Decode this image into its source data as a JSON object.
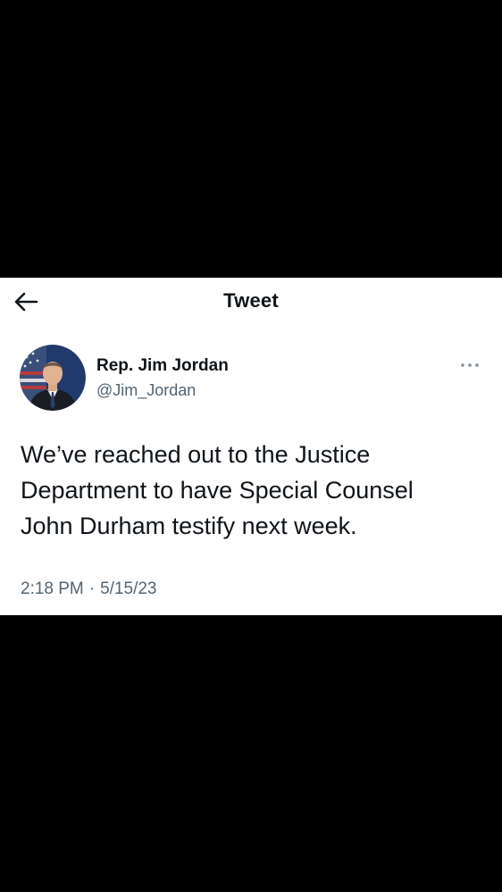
{
  "header": {
    "back_icon": "arrow-left-icon",
    "title": "Tweet"
  },
  "tweet": {
    "author": {
      "display_name": "Rep. Jim Jordan",
      "handle": "@Jim_Jordan",
      "avatar": "profile-photo"
    },
    "more_icon": "more-horizontal-icon",
    "text": "We’ve reached out to the Justice\nDepartment to have Special Counsel\nJohn Durham testify next week.",
    "time": "2:18 PM",
    "separator": "·",
    "date": "5/15/23"
  },
  "colors": {
    "background": "#000000",
    "card": "#ffffff",
    "primary_text": "#0f1419",
    "secondary_text": "#536471",
    "more_icon": "#8b98a5"
  }
}
